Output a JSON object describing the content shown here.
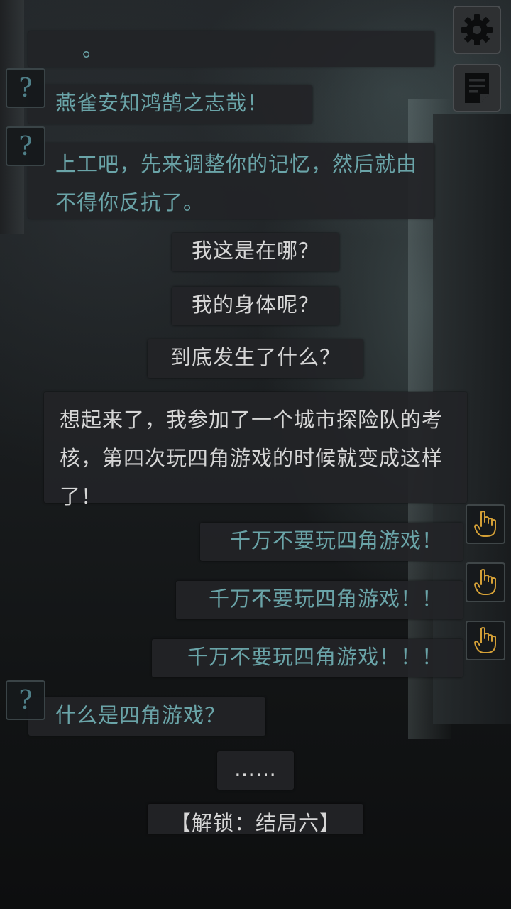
{
  "toolbar": {
    "settings_icon": "gear-icon",
    "log_icon": "notepad-icon"
  },
  "colors": {
    "npc_text": "#6aa4a8",
    "player_text": "#d6d6d6",
    "hand_icon": "#d4a037",
    "question_icon": "#4f7f88",
    "bubble_bg": "#222427"
  },
  "messages": [
    {
      "speaker": "npc",
      "text": "。",
      "icon": ""
    },
    {
      "speaker": "npc",
      "text": "燕雀安知鸿鹄之志哉！",
      "icon": "question-mark-icon"
    },
    {
      "speaker": "npc",
      "text": "上工吧，先来调整你的记忆，然后就由不得你反抗了。",
      "icon": "question-mark-icon"
    },
    {
      "speaker": "player",
      "text": "我这是在哪？"
    },
    {
      "speaker": "player",
      "text": "我的身体呢？"
    },
    {
      "speaker": "player",
      "text": "到底发生了什么？"
    },
    {
      "speaker": "player",
      "text": "想起来了，我参加了一个城市探险队的考核，第四次玩四角游戏的时候就变成这样了！"
    },
    {
      "speaker": "warning",
      "text": "千万不要玩四角游戏！",
      "icon": "pointing-hand-icon"
    },
    {
      "speaker": "warning",
      "text": "千万不要玩四角游戏！！",
      "icon": "pointing-hand-icon"
    },
    {
      "speaker": "warning",
      "text": "千万不要玩四角游戏！！！",
      "icon": "pointing-hand-icon"
    },
    {
      "speaker": "npc",
      "text": "什么是四角游戏？",
      "icon": "question-mark-icon"
    },
    {
      "speaker": "player",
      "text": "……"
    },
    {
      "speaker": "system",
      "text": "【解锁：结局六】"
    }
  ]
}
